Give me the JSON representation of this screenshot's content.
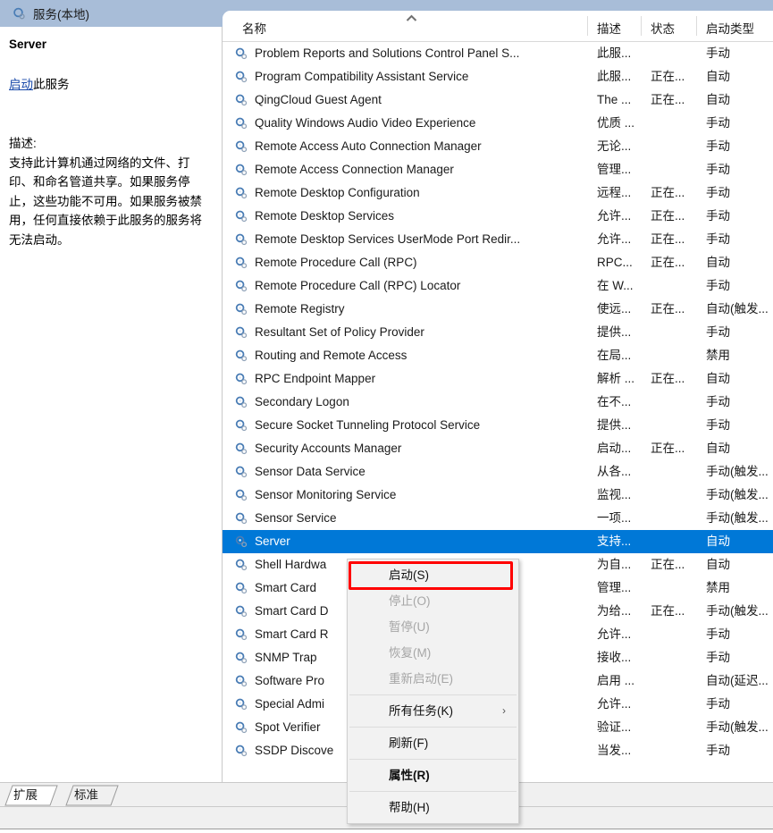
{
  "window": {
    "band_title": "服务(本地)",
    "band_icon": "services-gear-icon"
  },
  "details_pane": {
    "service_name": "Server",
    "action_link": "启动",
    "action_suffix": "此服务",
    "description_label": "描述:",
    "description_text": "支持此计算机通过网络的文件、打印、和命名管道共享。如果服务停止，这些功能不可用。如果服务被禁用，任何直接依赖于此服务的服务将无法启动。"
  },
  "list": {
    "columns": {
      "name": "名称",
      "description": "描述",
      "status": "状态",
      "startup": "启动类型"
    },
    "sort_indicator": "ascending-sort-chevron-icon",
    "rows": [
      {
        "name": "Problem Reports and Solutions Control Panel S...",
        "desc": "此服...",
        "status": "",
        "startup": "手动"
      },
      {
        "name": "Program Compatibility Assistant Service",
        "desc": "此服...",
        "status": "正在...",
        "startup": "自动"
      },
      {
        "name": "QingCloud Guest Agent",
        "desc": "The ...",
        "status": "正在...",
        "startup": "自动"
      },
      {
        "name": "Quality Windows Audio Video Experience",
        "desc": "优质 ...",
        "status": "",
        "startup": "手动"
      },
      {
        "name": "Remote Access Auto Connection Manager",
        "desc": "无论...",
        "status": "",
        "startup": "手动"
      },
      {
        "name": "Remote Access Connection Manager",
        "desc": "管理...",
        "status": "",
        "startup": "手动"
      },
      {
        "name": "Remote Desktop Configuration",
        "desc": "远程...",
        "status": "正在...",
        "startup": "手动"
      },
      {
        "name": "Remote Desktop Services",
        "desc": "允许...",
        "status": "正在...",
        "startup": "手动"
      },
      {
        "name": "Remote Desktop Services UserMode Port Redir...",
        "desc": "允许...",
        "status": "正在...",
        "startup": "手动"
      },
      {
        "name": "Remote Procedure Call (RPC)",
        "desc": "RPC...",
        "status": "正在...",
        "startup": "自动"
      },
      {
        "name": "Remote Procedure Call (RPC) Locator",
        "desc": "在 W...",
        "status": "",
        "startup": "手动"
      },
      {
        "name": "Remote Registry",
        "desc": "使远...",
        "status": "正在...",
        "startup": "自动(触发..."
      },
      {
        "name": "Resultant Set of Policy Provider",
        "desc": "提供...",
        "status": "",
        "startup": "手动"
      },
      {
        "name": "Routing and Remote Access",
        "desc": "在局...",
        "status": "",
        "startup": "禁用"
      },
      {
        "name": "RPC Endpoint Mapper",
        "desc": "解析 ...",
        "status": "正在...",
        "startup": "自动"
      },
      {
        "name": "Secondary Logon",
        "desc": "在不...",
        "status": "",
        "startup": "手动"
      },
      {
        "name": "Secure Socket Tunneling Protocol Service",
        "desc": "提供...",
        "status": "",
        "startup": "手动"
      },
      {
        "name": "Security Accounts Manager",
        "desc": "启动...",
        "status": "正在...",
        "startup": "自动"
      },
      {
        "name": "Sensor Data Service",
        "desc": "从各...",
        "status": "",
        "startup": "手动(触发..."
      },
      {
        "name": "Sensor Monitoring Service",
        "desc": "监视...",
        "status": "",
        "startup": "手动(触发..."
      },
      {
        "name": "Sensor Service",
        "desc": "一项...",
        "status": "",
        "startup": "手动(触发..."
      },
      {
        "name": "Server",
        "desc": "支持...",
        "status": "",
        "startup": "自动",
        "selected": true
      },
      {
        "name": "Shell Hardwa",
        "desc": "为自...",
        "status": "正在...",
        "startup": "自动"
      },
      {
        "name": "Smart Card",
        "desc": "管理...",
        "status": "",
        "startup": "禁用"
      },
      {
        "name": "Smart Card D",
        "desc": "为给...",
        "status": "正在...",
        "startup": "手动(触发..."
      },
      {
        "name": "Smart Card R",
        "desc": "允许...",
        "status": "",
        "startup": "手动"
      },
      {
        "name": "SNMP Trap",
        "desc": "接收...",
        "status": "",
        "startup": "手动"
      },
      {
        "name": "Software Pro",
        "desc": "启用 ...",
        "status": "",
        "startup": "自动(延迟..."
      },
      {
        "name": "Special Admi",
        "desc": "允许...",
        "status": "",
        "startup": "手动"
      },
      {
        "name": "Spot Verifier",
        "desc": "验证...",
        "status": "",
        "startup": "手动(触发..."
      },
      {
        "name": "SSDP Discove",
        "desc": "当发...",
        "status": "",
        "startup": "手动"
      }
    ]
  },
  "context_menu": {
    "items": [
      {
        "label": "启动(S)",
        "disabled": false,
        "highlighted": true
      },
      {
        "label": "停止(O)",
        "disabled": true
      },
      {
        "label": "暂停(U)",
        "disabled": true
      },
      {
        "label": "恢复(M)",
        "disabled": true
      },
      {
        "label": "重新启动(E)",
        "disabled": true
      },
      {
        "separator": true
      },
      {
        "label": "所有任务(K)",
        "disabled": false,
        "submenu": true
      },
      {
        "separator": true
      },
      {
        "label": "刷新(F)",
        "disabled": false
      },
      {
        "separator": true
      },
      {
        "label": "属性(R)",
        "disabled": false,
        "bold": true
      },
      {
        "separator": true
      },
      {
        "label": "帮助(H)",
        "disabled": false
      }
    ]
  },
  "tabs": [
    {
      "label": "扩展",
      "active": true
    },
    {
      "label": "标准",
      "active": false
    }
  ],
  "colors": {
    "band": "#a8bdd8",
    "selection": "#0078d7",
    "link": "#1849a9",
    "highlight": "#ff0000"
  }
}
